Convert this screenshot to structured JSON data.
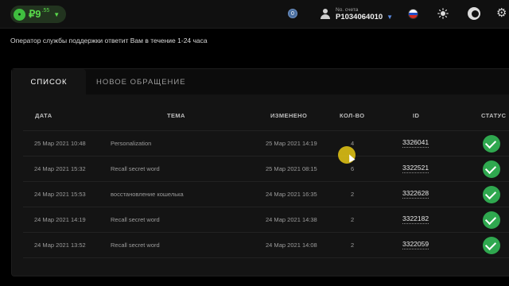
{
  "header": {
    "balance_main": "₽9",
    "balance_cents": ".55",
    "notifications_count": "0",
    "account_label": "No. счета",
    "account_number": "P1034064010"
  },
  "notice": "Оператор службы поддержки ответит Вам в течение 1-24 часа",
  "tabs": {
    "list": "СПИСОК",
    "new_ticket": "НОВОЕ ОБРАЩЕНИЕ"
  },
  "table": {
    "headers": {
      "date": "ДАТА",
      "topic": "ТЕМА",
      "changed": "ИЗМЕНЕНО",
      "count": "КОЛ-ВО",
      "id": "ID",
      "status": "СТАТУС"
    },
    "rows": [
      {
        "date": "25 Мар 2021 10:48",
        "topic": "Personalization",
        "changed": "25 Мар 2021 14:19",
        "count": "4",
        "id": "3326041",
        "status": "done"
      },
      {
        "date": "24 Мар 2021 15:32",
        "topic": "Recall secret word",
        "changed": "25 Мар 2021 08:15",
        "count": "6",
        "id": "3322521",
        "status": "done"
      },
      {
        "date": "24 Мар 2021 15:53",
        "topic": "восстановление кошелька",
        "changed": "24 Мар 2021 16:35",
        "count": "2",
        "id": "3322628",
        "status": "done"
      },
      {
        "date": "24 Мар 2021 14:19",
        "topic": "Recall secret word",
        "changed": "24 Мар 2021 14:38",
        "count": "2",
        "id": "3322182",
        "status": "done"
      },
      {
        "date": "24 Мар 2021 13:52",
        "topic": "Recall secret word",
        "changed": "24 Мар 2021 14:08",
        "count": "2",
        "id": "3322059",
        "status": "done"
      }
    ]
  },
  "colors": {
    "accent_green": "#59d84b",
    "status_green": "#2fa84f",
    "cursor_highlight": "#e6c814"
  }
}
